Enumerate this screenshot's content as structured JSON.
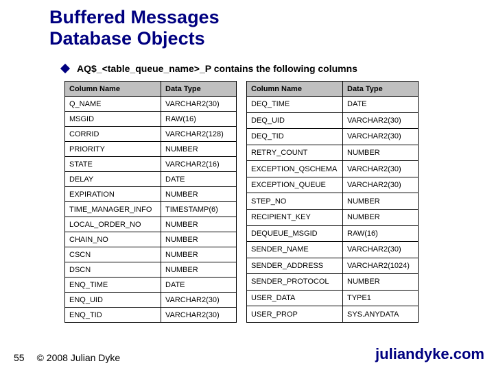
{
  "title": {
    "line1": "Buffered Messages",
    "line2": "Database Objects"
  },
  "bullet": "AQ$_<table_queue_name>_P contains the following columns",
  "headers": {
    "colname": "Column Name",
    "datatype": "Data Type"
  },
  "left_rows": [
    {
      "name": "Q_NAME",
      "type": "VARCHAR2(30)"
    },
    {
      "name": "MSGID",
      "type": "RAW(16)"
    },
    {
      "name": "CORRID",
      "type": "VARCHAR2(128)"
    },
    {
      "name": "PRIORITY",
      "type": "NUMBER"
    },
    {
      "name": "STATE",
      "type": "VARCHAR2(16)"
    },
    {
      "name": "DELAY",
      "type": "DATE"
    },
    {
      "name": "EXPIRATION",
      "type": "NUMBER"
    },
    {
      "name": "TIME_MANAGER_INFO",
      "type": "TIMESTAMP(6)"
    },
    {
      "name": "LOCAL_ORDER_NO",
      "type": "NUMBER"
    },
    {
      "name": "CHAIN_NO",
      "type": "NUMBER"
    },
    {
      "name": "CSCN",
      "type": "NUMBER"
    },
    {
      "name": "DSCN",
      "type": "NUMBER"
    },
    {
      "name": "ENQ_TIME",
      "type": "DATE"
    },
    {
      "name": "ENQ_UID",
      "type": "VARCHAR2(30)"
    },
    {
      "name": "ENQ_TID",
      "type": "VARCHAR2(30)"
    }
  ],
  "right_rows": [
    {
      "name": "DEQ_TIME",
      "type": "DATE"
    },
    {
      "name": "DEQ_UID",
      "type": "VARCHAR2(30)"
    },
    {
      "name": "DEQ_TID",
      "type": "VARCHAR2(30)"
    },
    {
      "name": "RETRY_COUNT",
      "type": "NUMBER"
    },
    {
      "name": "EXCEPTION_QSCHEMA",
      "type": "VARCHAR2(30)"
    },
    {
      "name": "EXCEPTION_QUEUE",
      "type": "VARCHAR2(30)"
    },
    {
      "name": "STEP_NO",
      "type": "NUMBER"
    },
    {
      "name": "RECIPIENT_KEY",
      "type": "NUMBER"
    },
    {
      "name": "DEQUEUE_MSGID",
      "type": "RAW(16)"
    },
    {
      "name": "SENDER_NAME",
      "type": "VARCHAR2(30)"
    },
    {
      "name": "SENDER_ADDRESS",
      "type": "VARCHAR2(1024)"
    },
    {
      "name": "SENDER_PROTOCOL",
      "type": "NUMBER"
    },
    {
      "name": "USER_DATA",
      "type": "TYPE1"
    },
    {
      "name": "USER_PROP",
      "type": "SYS.ANYDATA"
    }
  ],
  "footer": {
    "page": "55",
    "copyright": "© 2008 Julian Dyke",
    "site": "juliandyke.com"
  }
}
